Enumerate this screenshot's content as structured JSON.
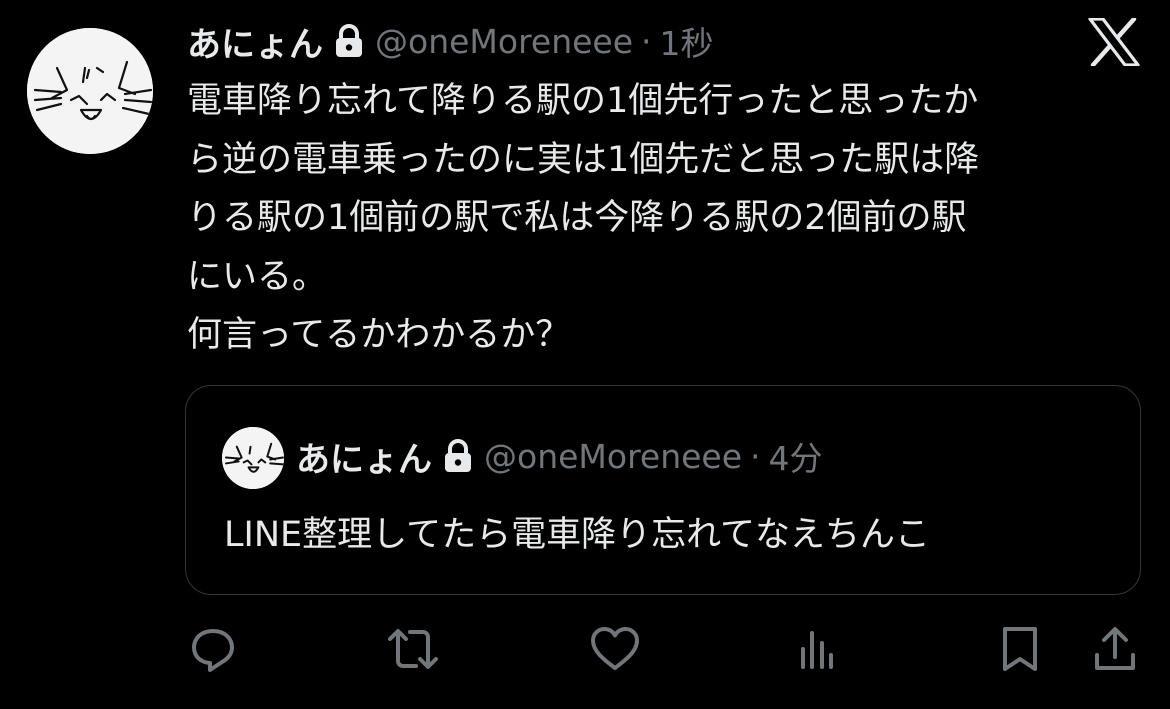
{
  "tweet": {
    "display_name": "あにょん",
    "handle": "@oneMoreneee",
    "separator": "·",
    "time": "1秒",
    "text_lines": [
      "電車降り忘れて降りる駅の1個先行ったと思ったか",
      "ら逆の電車乗ったのに実は1個先だと思った駅は降",
      "りる駅の1個前の駅で私は今降りる駅の2個前の駅",
      "にいる。",
      "何言ってるかわかるか？"
    ]
  },
  "quote": {
    "display_name": "あにょん",
    "handle": "@oneMoreneee",
    "separator": "·",
    "time": "4分",
    "text": "LINE整理してたら電車降り忘れてなえちんこ"
  },
  "icons": {
    "lock": "lock-icon",
    "x_logo": "x-logo-icon",
    "reply": "reply-icon",
    "retweet": "retweet-icon",
    "like": "heart-icon",
    "views": "views-icon",
    "bookmark": "bookmark-icon",
    "share": "share-icon"
  },
  "colors": {
    "background": "#000000",
    "text": "#e7e9ea",
    "secondary": "#71767b",
    "border": "#333639"
  }
}
